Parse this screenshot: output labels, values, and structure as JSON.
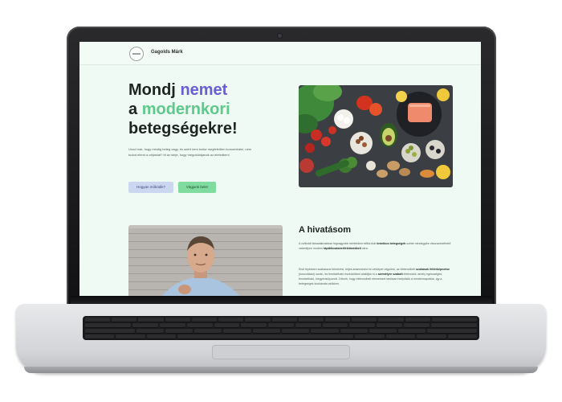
{
  "site": {
    "brand": "Gagolds Márk"
  },
  "hero": {
    "line1_a": "Mondj",
    "line1_b": "nemet",
    "line2_a": "a",
    "line2_b": "modernkori",
    "line3": "betegségekre!",
    "text": "Unod már, hogy mindig beteg vagy, és azért nem tudsz megfelelően koncentrálni, nem tudod elérni a céljaidat? Itt az ideje, hogy megoldódjanak az életedben!",
    "button_primary": "Hogyan működik?",
    "button_secondary": "Vágjunk bele!"
  },
  "about": {
    "title": "A hivatásom",
    "p1_a": "A civilizált társadalmakban legnagyobb mértékben előforduló",
    "p1_b": "krónikus betegségek",
    "p1_c": "szinte mindegyike visszavezethető valamilyen modern",
    "p1_d": "táplálkozásbeli/életmódbeli",
    "p1_e": "okra.",
    "p2_a": "Első lépésben szakaszos felmérést, teljes anamnézist és vérképet végzünk, az életmódbeli",
    "p2_b": "szokások feltérképezése",
    "p2_c": "(konzultáció) során, és fenntartható eszközökkel alakítjuk ki a",
    "p2_d": "személyre szabott",
    "p2_e": "életmódot, amely egészséges, fenntartható, kiegyensúlyozott. Célunk, hogy életmódbeli elemeinket tartósan beépítsük a mindennapokba, így a betegségek kockázata csökken."
  },
  "colors": {
    "accent_purple": "#6b5dd3",
    "accent_green": "#5fc98b",
    "page_bg": "#eefaf3"
  }
}
